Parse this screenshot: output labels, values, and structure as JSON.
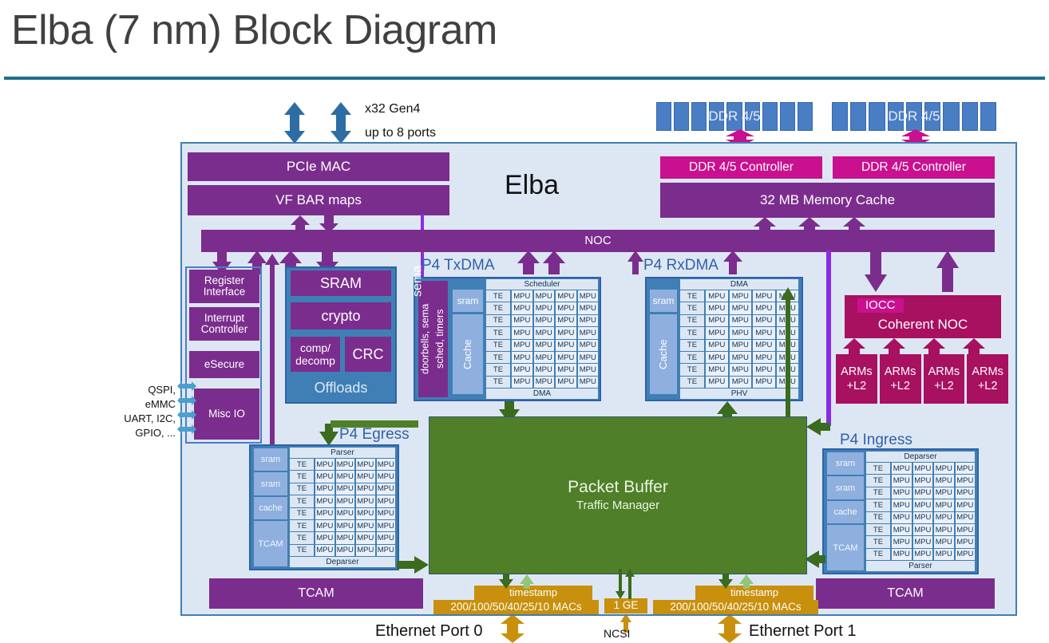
{
  "header": {
    "title": "Elba (7 nm) Block Diagram"
  },
  "chip": {
    "name": "Elba"
  },
  "pcie": {
    "annotation_line1": "x32 Gen4",
    "annotation_line2": "up to 8 ports",
    "mac_label": "PCIe MAC",
    "vf_bar_label": "VF BAR maps"
  },
  "memory": {
    "ddr_left_label": "DDR 4/5",
    "ddr_right_label": "DDR 4/5",
    "ddr_cells_per_group": 9,
    "controller_left": "DDR 4/5 Controller",
    "controller_right": "DDR 4/5 Controller",
    "cache_label": "32 MB Memory Cache"
  },
  "noc": {
    "label": "NOC"
  },
  "left_column": {
    "register_interface": "Register Interface",
    "interrupt_controller": "Interrupt Controller",
    "esecure": "eSecure",
    "misc_io": "Misc IO",
    "io_pins": [
      "QSPI,",
      "eMMC",
      "UART, I2C,",
      "GPIO, ..."
    ]
  },
  "offloads": {
    "title": "Offloads",
    "sram": "SRAM",
    "crypto": "crypto",
    "comp": "comp/ decomp",
    "crc": "CRC"
  },
  "txdma": {
    "section_label": "P4 TxDMA",
    "sidebar": "doorbells,",
    "sidebar2": "sched, timers",
    "sidebar3": "sema",
    "sram": "sram",
    "cache": "Cache",
    "top_band": "Scheduler",
    "bottom_band": "DMA",
    "rows": 8,
    "te": "TE",
    "mpu": "MPU",
    "mpus_per_row": 4
  },
  "rxdma": {
    "section_label": "P4 RxDMA",
    "sram": "sram",
    "cache": "Cache",
    "top_band": "DMA",
    "bottom_band": "PHV",
    "rows": 8,
    "te": "TE",
    "mpu": "MPU",
    "mpus_per_row": 4
  },
  "coherent": {
    "iocc": "IOCC",
    "noc": "Coherent NOC",
    "arms": [
      "ARMs +L2",
      "ARMs +L2",
      "ARMs +L2",
      "ARMs +L2"
    ]
  },
  "egress": {
    "section_label": "P4 Egress",
    "mem": [
      "sram",
      "sram",
      "cache",
      "TCAM"
    ],
    "top_band": "Parser",
    "bottom_band": "Deparser",
    "rows": 8,
    "te": "TE",
    "mpu": "MPU",
    "mpus_per_row": 4
  },
  "ingress": {
    "section_label": "P4 Ingress",
    "mem": [
      "sram",
      "sram",
      "cache",
      "TCAM"
    ],
    "top_band": "Deparser",
    "bottom_band": "Parser",
    "rows": 8,
    "te": "TE",
    "mpu": "MPU",
    "mpus_per_row": 4
  },
  "packet_buffer": {
    "title": "Packet Buffer",
    "subtitle": "Traffic Manager"
  },
  "bottom": {
    "tcam_left": "TCAM",
    "tcam_right": "TCAM",
    "timestamp_left": "timestamp",
    "timestamp_right": "timestamp",
    "macs_left": "200/100/50/40/25/10 MACs",
    "macs_right": "200/100/50/40/25/10 MACs",
    "one_ge": "1 GE",
    "ncsi": "NCSI",
    "eth_port_0": "Ethernet Port  0",
    "eth_port_1": "Ethernet Port  1"
  },
  "colors": {
    "purple": "#7b2d8e",
    "magenta": "#c9108f",
    "crimson": "#a81060",
    "blue": "#4a7ec4",
    "light_blue": "#8fb0df",
    "chip_bg": "#dde7f3",
    "green": "#4f7f28",
    "gold": "#c8900d",
    "rule": "#1f6f8b",
    "arrow_blue": "#2e6da4",
    "arrow_purple": "#8a2be2"
  }
}
